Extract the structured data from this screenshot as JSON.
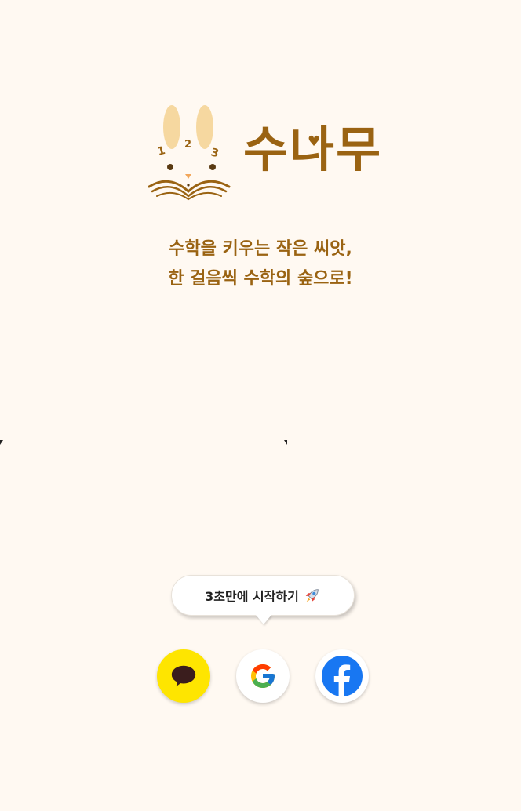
{
  "brand": {
    "name": "수나무",
    "mascot_numbers": [
      "1",
      "2",
      "3"
    ]
  },
  "tagline": {
    "line1": "수학을 키우는 작은 씨앗,",
    "line2": "한 걸음씩 수학의 숲으로!"
  },
  "tooltip": {
    "text": "3초만에 시작하기",
    "icon": "rocket-icon"
  },
  "login": {
    "buttons": [
      {
        "provider": "kakao",
        "icon": "kakao-talk-icon",
        "color": "#FEE500"
      },
      {
        "provider": "google",
        "icon": "google-icon",
        "color": "#FFFFFF"
      },
      {
        "provider": "facebook",
        "icon": "facebook-icon",
        "color": "#1877F2"
      }
    ]
  },
  "colors": {
    "background": "#FFF9F2",
    "brand": "#9A6312",
    "kakao": "#FEE500",
    "facebook": "#1877F2"
  }
}
